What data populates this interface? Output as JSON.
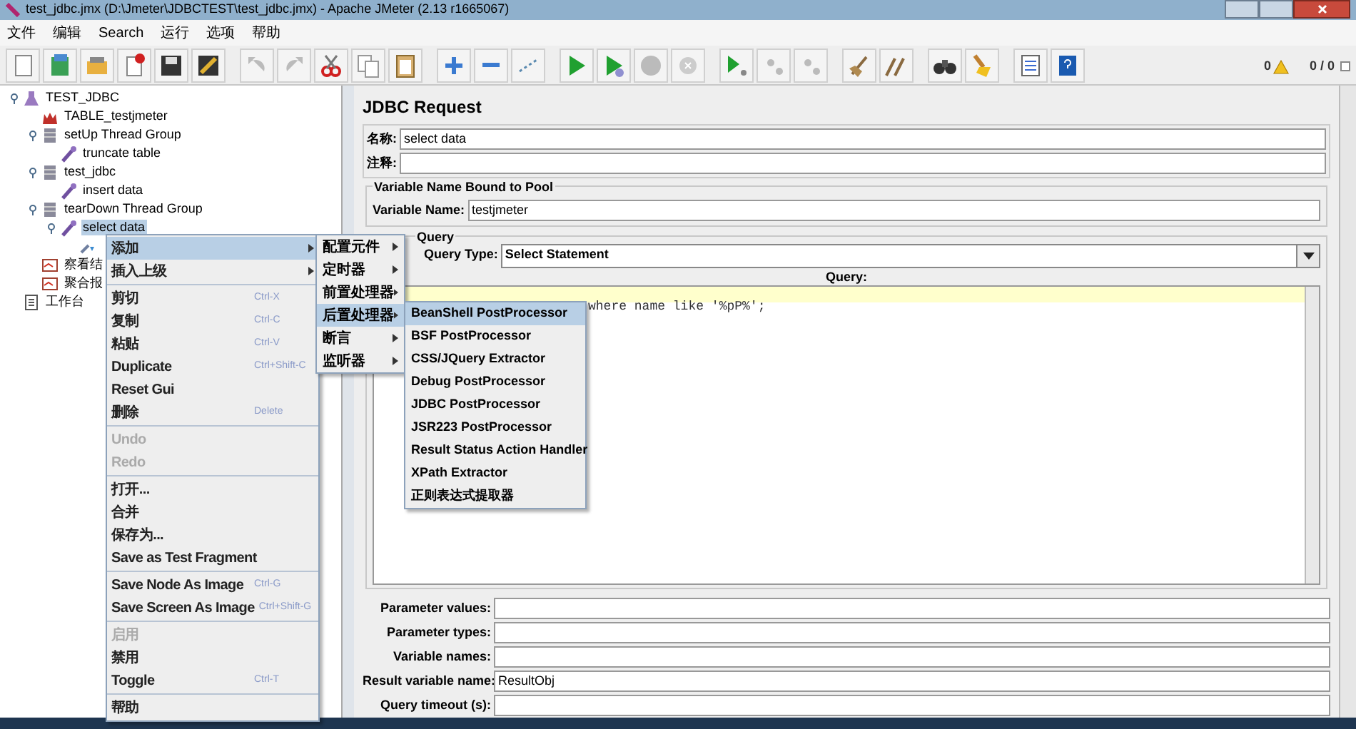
{
  "window": {
    "title": "test_jdbc.jmx (D:\\Jmeter\\JDBCTEST\\test_jdbc.jmx) - Apache JMeter (2.13 r1665067)"
  },
  "menu_bar": [
    "文件",
    "编辑",
    "Search",
    "运行",
    "选项",
    "帮助"
  ],
  "status": {
    "warnings": "0",
    "threads": "0 / 0"
  },
  "tree": [
    {
      "label": "TEST_JDBC",
      "kind": "plan",
      "selected": false,
      "children": [
        {
          "label": "TABLE_testjmeter",
          "kind": "config",
          "selected": false
        },
        {
          "label": "setUp Thread Group",
          "kind": "group",
          "selected": false,
          "children": [
            {
              "label": "truncate table",
              "kind": "sampler",
              "selected": false
            }
          ]
        },
        {
          "label": "test_jdbc",
          "kind": "group",
          "selected": false,
          "children": [
            {
              "label": "insert data",
              "kind": "sampler",
              "selected": false
            }
          ]
        },
        {
          "label": "tearDown Thread Group",
          "kind": "group",
          "selected": false,
          "children": [
            {
              "label": "select data",
              "kind": "sampler",
              "selected": true,
              "children": [
                {
                  "kind": "post"
                }
              ]
            }
          ]
        },
        {
          "label": "察看结",
          "kind": "listener",
          "selected": false
        },
        {
          "label": "聚合报",
          "kind": "listener",
          "selected": false
        }
      ]
    },
    {
      "label": "工作台",
      "kind": "workbench",
      "selected": false
    }
  ],
  "context_menu": [
    [
      {
        "label": "添加",
        "submenu": true,
        "selected": true,
        "disabled": false
      },
      {
        "label": "插入上级",
        "submenu": true,
        "selected": false,
        "disabled": false
      }
    ],
    [
      {
        "label": "剪切",
        "shortcut": "Ctrl-X",
        "selected": false,
        "disabled": false
      },
      {
        "label": "复制",
        "shortcut": "Ctrl-C",
        "selected": false,
        "disabled": false
      },
      {
        "label": "粘贴",
        "shortcut": "Ctrl-V",
        "selected": false,
        "disabled": false
      },
      {
        "label": "Duplicate",
        "shortcut": "Ctrl+Shift-C",
        "selected": false,
        "disabled": false
      },
      {
        "label": "Reset Gui",
        "selected": false,
        "disabled": false
      },
      {
        "label": "删除",
        "shortcut": "Delete",
        "selected": false,
        "disabled": false
      }
    ],
    [
      {
        "label": "Undo",
        "selected": false,
        "disabled": true
      },
      {
        "label": "Redo",
        "selected": false,
        "disabled": true
      }
    ],
    [
      {
        "label": "打开...",
        "selected": false,
        "disabled": false
      },
      {
        "label": "合并",
        "selected": false,
        "disabled": false
      },
      {
        "label": "保存为...",
        "selected": false,
        "disabled": false
      },
      {
        "label": "Save as Test Fragment",
        "selected": false,
        "disabled": false
      }
    ],
    [
      {
        "label": "Save Node As Image",
        "shortcut": "Ctrl-G",
        "selected": false,
        "disabled": false
      },
      {
        "label": "Save Screen As Image",
        "shortcut": "Ctrl+Shift-G",
        "selected": false,
        "disabled": false
      }
    ],
    [
      {
        "label": "启用",
        "selected": false,
        "disabled": true
      },
      {
        "label": "禁用",
        "selected": false,
        "disabled": false
      },
      {
        "label": "Toggle",
        "shortcut": "Ctrl-T",
        "selected": false,
        "disabled": false
      }
    ],
    [
      {
        "label": "帮助",
        "selected": false,
        "disabled": false
      }
    ]
  ],
  "submenu": [
    {
      "label": "配置元件",
      "selected": false
    },
    {
      "label": "定时器",
      "selected": false
    },
    {
      "label": "前置处理器",
      "selected": false
    },
    {
      "label": "后置处理器",
      "selected": true
    },
    {
      "label": "断言",
      "selected": false
    },
    {
      "label": "监听器",
      "selected": false
    }
  ],
  "submenu_items": [
    {
      "label": "BeanShell PostProcessor",
      "selected": true
    },
    {
      "label": "BSF PostProcessor",
      "selected": false
    },
    {
      "label": "CSS/JQuery Extractor",
      "selected": false
    },
    {
      "label": "Debug PostProcessor",
      "selected": false
    },
    {
      "label": "JDBC PostProcessor",
      "selected": false
    },
    {
      "label": "JSR223 PostProcessor",
      "selected": false
    },
    {
      "label": "Result Status Action Handler",
      "selected": false
    },
    {
      "label": "XPath Extractor",
      "selected": false
    },
    {
      "label": "正则表达式提取器",
      "selected": false
    }
  ],
  "panel": {
    "title": "JDBC Request",
    "name_label": "名称:",
    "name": "select data",
    "comment_label": "注释:",
    "pool_group": "Variable Name Bound to Pool",
    "variable_label": "Variable Name:",
    "variable": "testjmeter",
    "query_group": "Query",
    "query_type_label": "Query Type:",
    "query_type": "Select Statement",
    "query_label": "Query:",
    "query_visible": "where name like '%pP%';",
    "params": [
      {
        "label": "Parameter values:"
      },
      {
        "label": "Parameter types:"
      },
      {
        "label": "Variable names:"
      },
      {
        "label": "Result variable name:",
        "value": "ResultObj"
      },
      {
        "label": "Query timeout (s):"
      }
    ]
  }
}
